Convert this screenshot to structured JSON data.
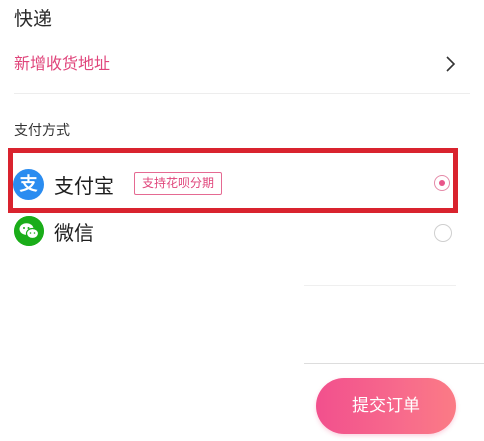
{
  "delivery": {
    "title": "快递",
    "address_link": "新增收货地址"
  },
  "payment": {
    "title": "支付方式",
    "options": [
      {
        "label": "支付宝",
        "icon": "alipay-icon",
        "icon_glyph": "支",
        "badge": "支持花呗分期",
        "selected": true
      },
      {
        "label": "微信",
        "icon": "wechat-icon",
        "selected": false
      }
    ]
  },
  "actions": {
    "submit_label": "提交订单"
  },
  "colors": {
    "accent": "#e0457b",
    "alipay_blue": "#2a8cf0",
    "wechat_green": "#1aad19",
    "highlight_red": "#d9232e"
  }
}
